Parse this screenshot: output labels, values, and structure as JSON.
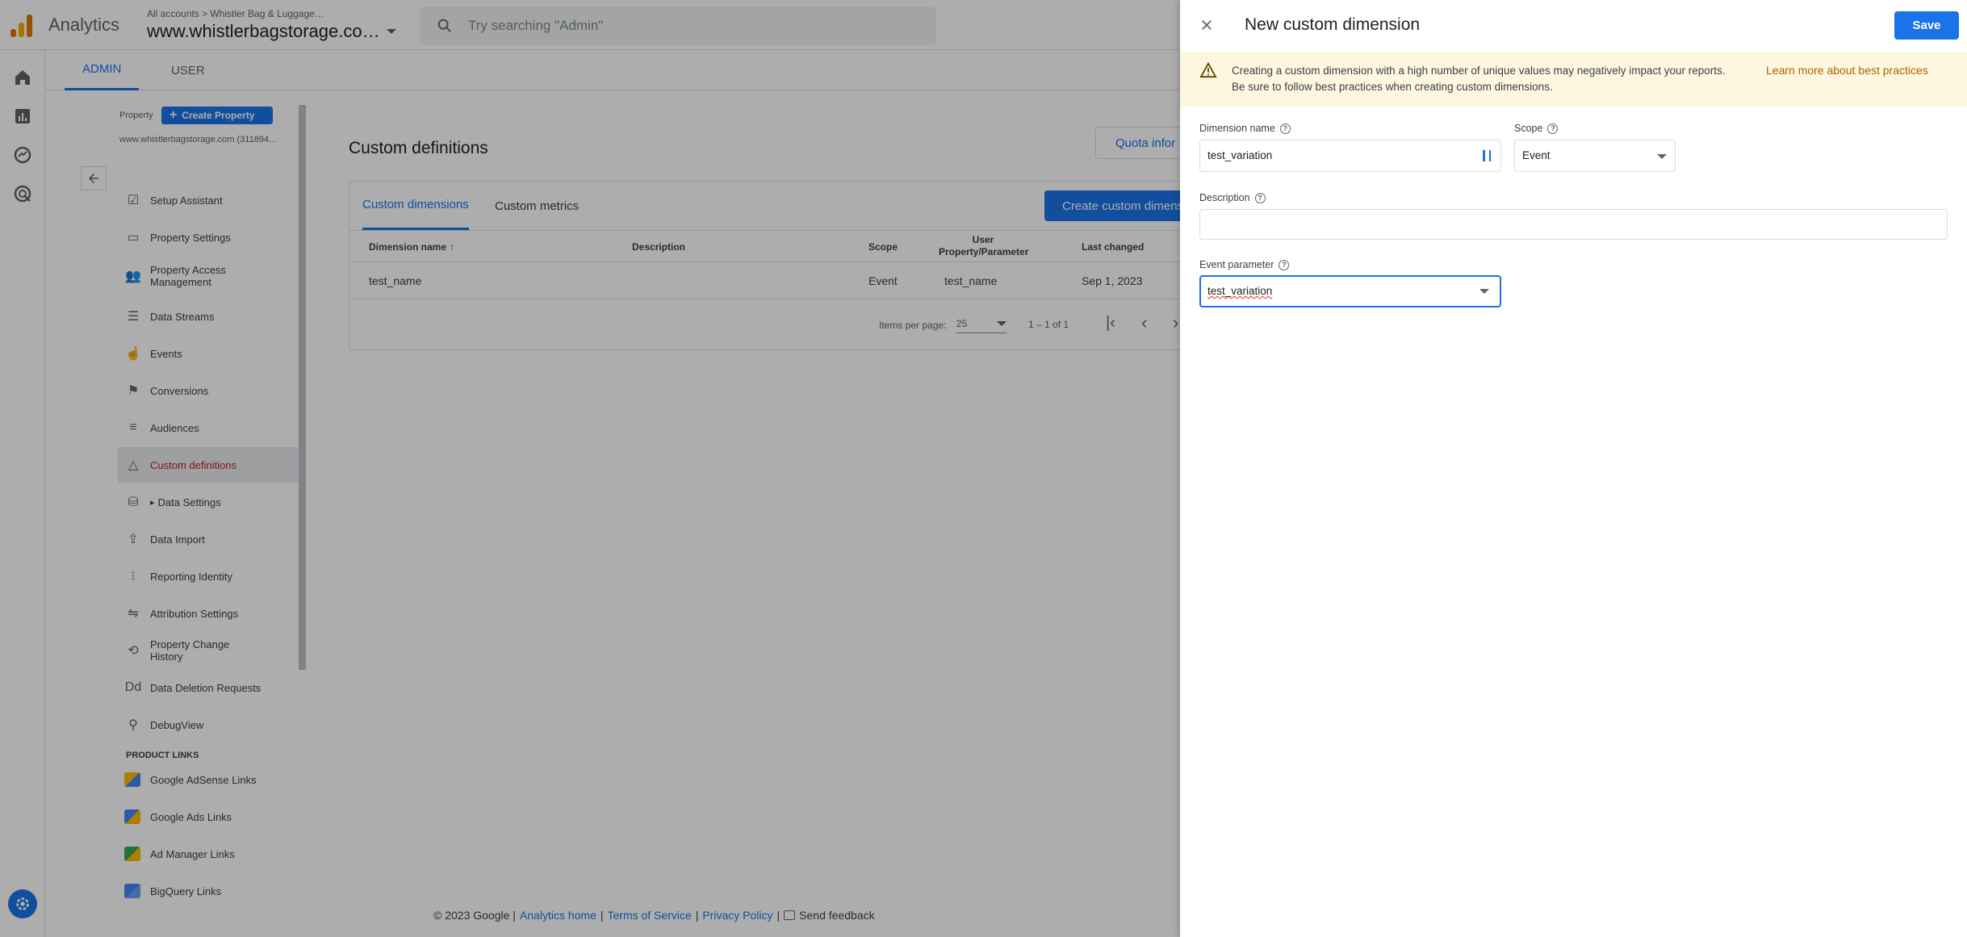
{
  "header": {
    "app_name": "Analytics",
    "breadcrumb": "All accounts > Whistler Bag & Luggage…",
    "property_name": "www.whistlerbagstorage.co…",
    "search_placeholder": "Try searching \"Admin\""
  },
  "tabs": {
    "admin": "ADMIN",
    "user": "USER"
  },
  "sidebar": {
    "property_label": "Property",
    "create_property": "Create Property",
    "property_id": "www.whistlerbagstorage.com (311894…",
    "items": [
      {
        "label": "Setup Assistant",
        "icon": "checkbox-icon"
      },
      {
        "label": "Property Settings",
        "icon": "window-icon"
      },
      {
        "label": "Property Access Management",
        "icon": "people-icon"
      },
      {
        "label": "Data Streams",
        "icon": "streams-icon"
      },
      {
        "label": "Events",
        "icon": "touch-icon"
      },
      {
        "label": "Conversions",
        "icon": "flag-icon"
      },
      {
        "label": "Audiences",
        "icon": "audience-icon"
      },
      {
        "label": "Custom definitions",
        "icon": "shapes-icon"
      },
      {
        "label": "Data Settings",
        "icon": "database-icon"
      },
      {
        "label": "Data Import",
        "icon": "upload-icon"
      },
      {
        "label": "Reporting Identity",
        "icon": "identity-icon"
      },
      {
        "label": "Attribution Settings",
        "icon": "attribution-icon"
      },
      {
        "label": "Property Change History",
        "icon": "history-icon"
      },
      {
        "label": "Data Deletion Requests",
        "icon": "dd-icon"
      },
      {
        "label": "DebugView",
        "icon": "debug-icon"
      }
    ],
    "product_links_heading": "PRODUCT LINKS",
    "product_links": [
      {
        "label": "Google AdSense Links"
      },
      {
        "label": "Google Ads Links"
      },
      {
        "label": "Ad Manager Links"
      },
      {
        "label": "BigQuery Links"
      }
    ]
  },
  "main": {
    "title": "Custom definitions",
    "quota_button": "Quota infor",
    "tab_dimensions": "Custom dimensions",
    "tab_metrics": "Custom metrics",
    "create_button": "Create custom dimensi",
    "columns": [
      "Dimension name",
      "Description",
      "Scope",
      "User Property/Parameter",
      "Last changed"
    ],
    "rows": [
      {
        "name": "test_name",
        "description": "",
        "scope": "Event",
        "param": "test_name",
        "changed": "Sep 1, 2023"
      }
    ],
    "items_per_page_label": "Items per page:",
    "items_per_page": "25",
    "range": "1 – 1 of 1"
  },
  "footer": {
    "copyright": "© 2023 Google |",
    "analytics_home": "Analytics home",
    "terms": "Terms of Service",
    "privacy": "Privacy Policy",
    "feedback": "Send feedback"
  },
  "panel": {
    "title": "New custom dimension",
    "save": "Save",
    "warning": "Creating a custom dimension with a high number of unique values may negatively impact your reports. Be sure to follow best practices when creating custom dimensions.",
    "learn_more": "Learn more about best practices",
    "dimension_name_label": "Dimension name",
    "dimension_name_value": "test_variation",
    "scope_label": "Scope",
    "scope_value": "Event",
    "description_label": "Description",
    "description_value": "",
    "event_param_label": "Event parameter",
    "event_param_value": "test_variation"
  },
  "colors": {
    "accent": "#1a73e8",
    "save_button": "#1a73e8",
    "warning_bg": "#fef7e0",
    "active_nav": "#c5221f"
  }
}
